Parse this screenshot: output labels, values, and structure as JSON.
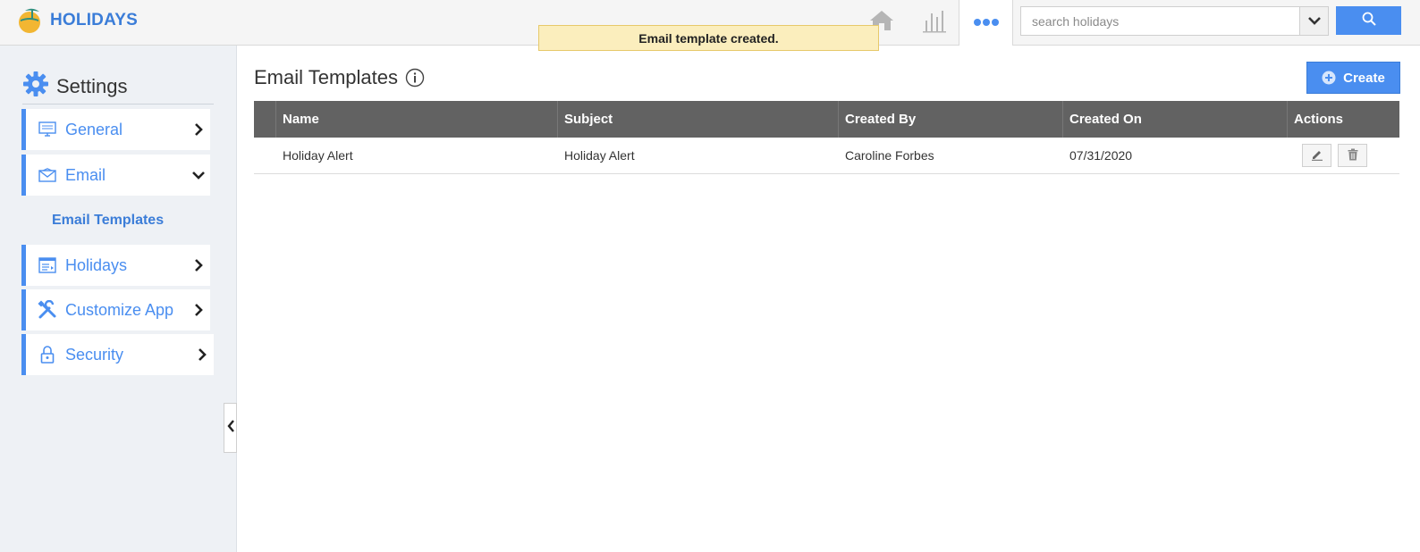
{
  "app": {
    "name": "HOLIDAYS"
  },
  "topbar": {
    "icons": [
      "home-icon",
      "bar-chart-icon",
      "more-dots-icon"
    ],
    "search": {
      "placeholder": "search holidays",
      "value": ""
    }
  },
  "toast": {
    "message": "Email template created."
  },
  "sidebar": {
    "title": "Settings",
    "items": [
      {
        "label": "General",
        "icon": "monitor-icon",
        "expanded": false
      },
      {
        "label": "Email",
        "icon": "envelope-icon",
        "expanded": true
      },
      {
        "label": "Holidays",
        "icon": "calendar-list-icon",
        "expanded": false
      },
      {
        "label": "Customize App",
        "icon": "tools-icon",
        "expanded": false
      },
      {
        "label": "Security",
        "icon": "lock-icon",
        "expanded": false
      }
    ],
    "email_sub": "Email Templates"
  },
  "main": {
    "title": "Email Templates",
    "create_label": "Create",
    "columns": [
      "Name",
      "Subject",
      "Created By",
      "Created On",
      "Actions"
    ],
    "rows": [
      {
        "name": "Holiday Alert",
        "subject": "Holiday Alert",
        "created_by": "Caroline Forbes",
        "created_on": "07/31/2020"
      }
    ]
  },
  "colors": {
    "accent": "#4a8ef0",
    "header_bg": "#626262",
    "toast_bg": "#fbeebd"
  }
}
